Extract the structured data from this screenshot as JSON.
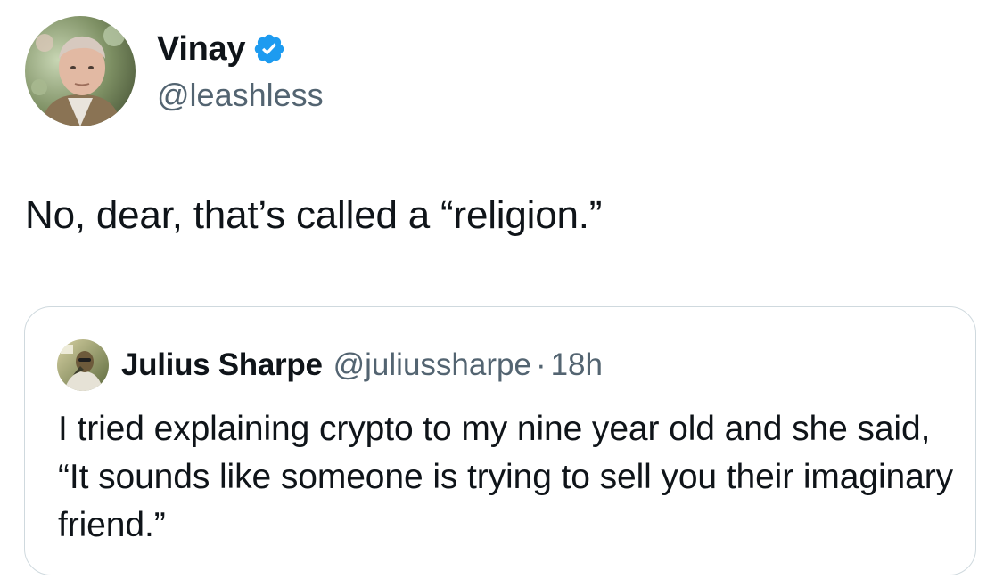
{
  "tweet": {
    "author": {
      "display_name": "Vinay",
      "handle": "@leashless",
      "verified": true,
      "avatar_icon": "avatar-photo",
      "verified_icon": "verified-badge-icon",
      "verified_color": "#1d9bf0"
    },
    "text": "No, dear, that’s called a “religion.”"
  },
  "quote": {
    "author": {
      "display_name": "Julius Sharpe",
      "handle": "@juliussharpe",
      "avatar_icon": "avatar-photo"
    },
    "separator": "·",
    "time": "18h",
    "text": "I tried explaining crypto to my nine year old and she said, “It sounds like someone is trying to sell you their imaginary friend.”"
  },
  "colors": {
    "text_primary": "#0f1419",
    "text_secondary": "#536471",
    "border": "#cfd9de",
    "background": "#ffffff"
  }
}
